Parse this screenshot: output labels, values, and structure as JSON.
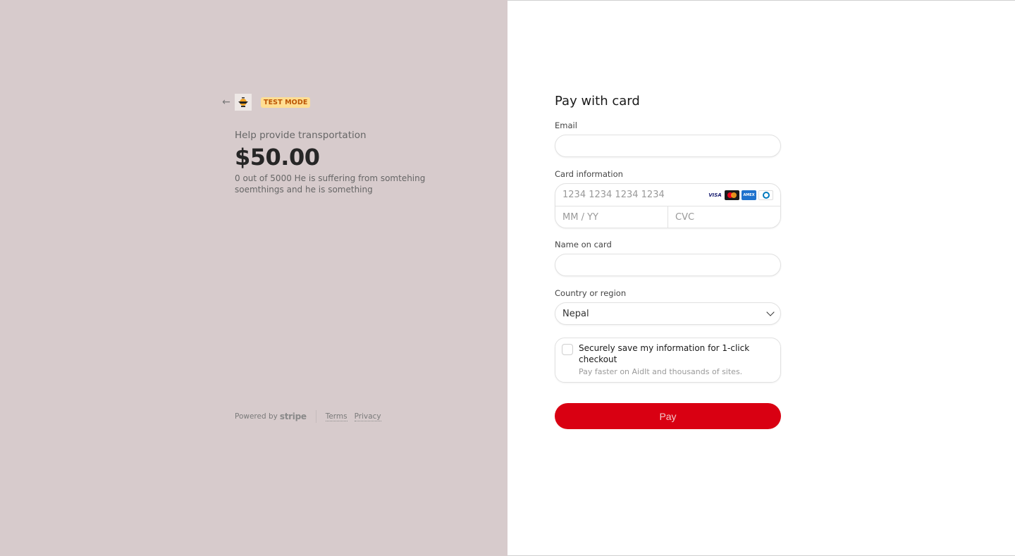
{
  "header": {
    "back_icon": "arrow-left-icon",
    "logo": "merchant-logo",
    "badge": "TEST MODE"
  },
  "product": {
    "name": "Help provide transportation",
    "price": "$50.00",
    "description": "0 out of 5000 He is suffering from somtehing soemthings and he is something"
  },
  "footer": {
    "powered_by": "Powered by",
    "brand": "stripe",
    "links": [
      "Terms",
      "Privacy"
    ]
  },
  "form": {
    "title": "Pay with card",
    "email": {
      "label": "Email",
      "value": "",
      "placeholder": ""
    },
    "card": {
      "label": "Card information",
      "number_placeholder": "1234 1234 1234 1234",
      "expiry_placeholder": "MM / YY",
      "cvc_placeholder": "CVC",
      "brands": [
        "VISA",
        "Mastercard",
        "American Express",
        "Diners Club"
      ]
    },
    "name": {
      "label": "Name on card",
      "value": ""
    },
    "country": {
      "label": "Country or region",
      "selected": "Nepal"
    },
    "save": {
      "checked": false,
      "label": "Securely save my information for 1-click checkout",
      "sub": "Pay faster on AidIt and thousands of sites."
    },
    "pay_label": "Pay"
  },
  "colors": {
    "left_bg": "#d7cbcc",
    "pay_button": "#d90012",
    "badge_bg": "#ffde92",
    "badge_text": "#bb5504"
  }
}
